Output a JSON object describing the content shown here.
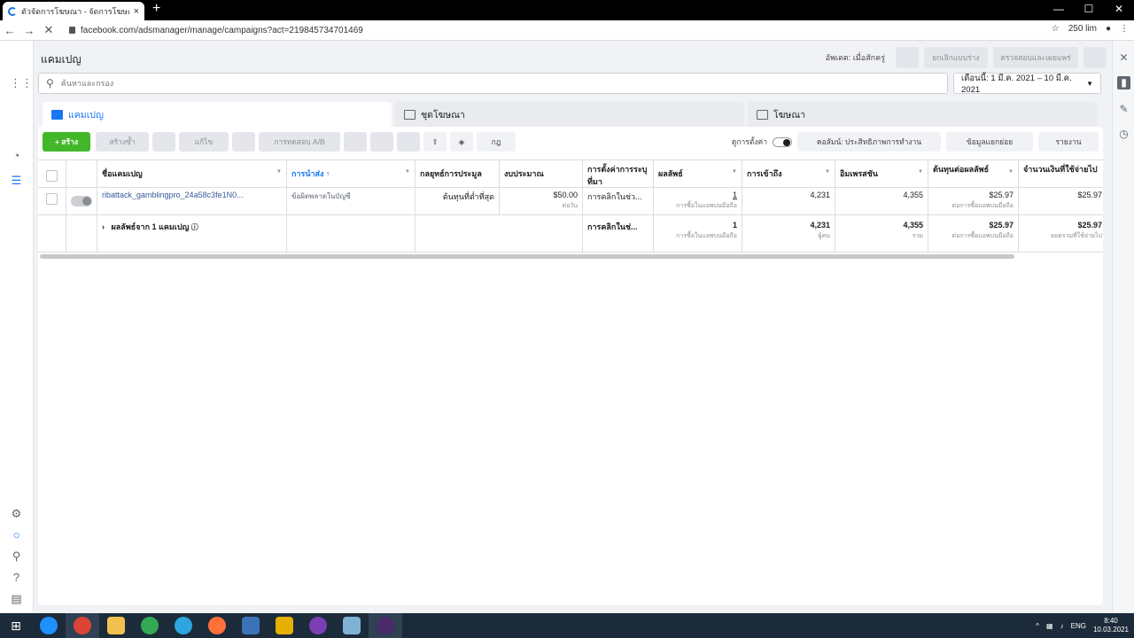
{
  "browser": {
    "tab_title": "ตัวจัดการโฆษณา - จัดการโฆษณา - แค",
    "tab_close": "×",
    "new_tab": "+",
    "url": "facebook.com/adsmanager/manage/campaigns?act=219845734701469",
    "extension": "250 lim",
    "win_minimize": "—",
    "win_maximize": "☐",
    "win_close": "✕"
  },
  "header": {
    "title": "แคมเปญ",
    "updated": "อัพเดต: เมื่อสักครู่",
    "discard_label": "ยกเลิกแบบร่าง",
    "review_label": "ตรวจสอบและเผยแพร่"
  },
  "search": {
    "placeholder": "ค้นหาและกรอง"
  },
  "date_range": "เดือนนี้: 1 มี.ค. 2021 – 10 มี.ค. 2021",
  "levels": [
    {
      "label": "แคมเปญ"
    },
    {
      "label": "ชุดโฆษณา"
    },
    {
      "label": "โฆษณา"
    }
  ],
  "toolbar": {
    "create": "+ สร้าง",
    "duplicate": "สร้างซ้ำ",
    "edit": "แก้ไข",
    "ab_test": "การทดสอบ A/B",
    "rules": "กฎ",
    "view_setup": "ดูการตั้งค่า",
    "columns": "คอลัมน์: ประสิทธิภาพการทำงาน",
    "breakdown": "ข้อมูลแยกย่อย",
    "reports": "รายงาน"
  },
  "table": {
    "headers": [
      "ชื่อแคมเปญ",
      "การนำส่ง ↑",
      "กลยุทธ์การประมูล",
      "งบประมาณ",
      "การตั้งค่าการระบุที่มา",
      "ผลลัพธ์",
      "การเข้าถึง",
      "อิมเพรสชัน",
      "ต้นทุนต่อผลลัพธ์",
      "จำนวนเงินที่ใช้จ่ายไป"
    ],
    "row": {
      "name": "ribattack_gamblingpro_24a58c3fe1N0...",
      "delivery": "ข้อผิดพลาดในบัญชี",
      "bid": "ต้นทุนที่ต่ำที่สุด",
      "budget": "$50.00",
      "budget_sub": "ต่อวัน",
      "attribution": "การคลิกในช่ว...",
      "results": "1",
      "results_sub": "การซื้อในแอพบนมือถือ",
      "reach": "4,231",
      "impressions": "4,355",
      "cost": "$25.97",
      "cost_sub": "ต่อการซื้อแอพบนมือถือ",
      "spent": "$25.97"
    },
    "summary": {
      "label": "ผลลัพธ์จาก 1 แคมเปญ",
      "attribution": "การคลิกในช่...",
      "results": "1",
      "results_sub": "การซื้อในแอพบนมือถือ",
      "reach": "4,231",
      "reach_sub": "ผู้คน",
      "impressions": "4,355",
      "impressions_sub": "รวม",
      "cost": "$25.97",
      "cost_sub": "ต่อการซื้อแอพบนมือถือ",
      "spent": "$25.97",
      "spent_sub": "ยอดรวมที่ใช้จ่ายไป"
    }
  },
  "taskbar": {
    "lang": "ENG",
    "time": "8:40",
    "date": "10.03.2021"
  }
}
